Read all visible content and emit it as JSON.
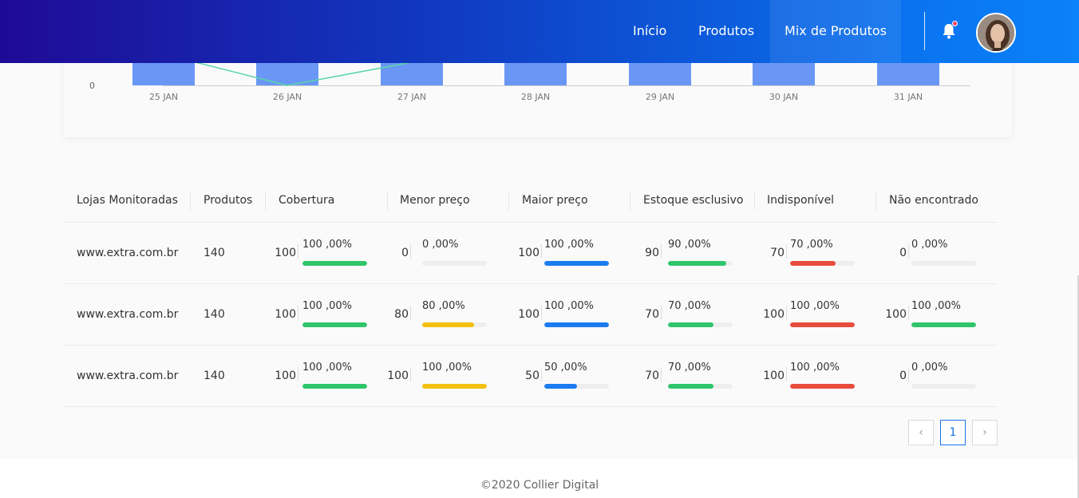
{
  "header": {
    "nav": [
      {
        "label": "Início"
      },
      {
        "label": "Produtos"
      },
      {
        "label": "Mix de Produtos"
      }
    ],
    "notification_badge": true,
    "icons": {
      "bell": "bell-icon",
      "avatar": "user-avatar"
    }
  },
  "chart_data": {
    "type": "bar",
    "categories": [
      "25 JAN",
      "26 JAN",
      "27 JAN",
      "28 JAN",
      "29 JAN",
      "30 JAN",
      "31 JAN"
    ],
    "y_visible_tick": "0",
    "bar_color": "#6a97f6",
    "line_color": "#5ad6a6",
    "line_points": [
      {
        "x": "25 JAN",
        "y": 0.6
      },
      {
        "x": "26 JAN",
        "y": 0
      },
      {
        "x": "27 JAN",
        "y": 0.6
      }
    ]
  },
  "table": {
    "headers": [
      "Lojas Monitoradas",
      "Produtos",
      "Cobertura",
      "Menor preço",
      "Maior preço",
      "Estoque esclusivo",
      "Indisponível",
      "Não encontrado"
    ],
    "rows": [
      {
        "store": "www.extra.com.br",
        "products": "140",
        "metrics": [
          {
            "num": "100",
            "pct": "100 ,00%",
            "value": 100
          },
          {
            "num": "0",
            "pct": "0 ,00%",
            "value": 0
          },
          {
            "num": "100",
            "pct": "100 ,00%",
            "value": 100
          },
          {
            "num": "90",
            "pct": "90 ,00%",
            "value": 90
          },
          {
            "num": "70",
            "pct": "70 ,00%",
            "value": 70
          },
          {
            "num": "0",
            "pct": "0 ,00%",
            "value": 0
          }
        ]
      },
      {
        "store": "www.extra.com.br",
        "products": "140",
        "metrics": [
          {
            "num": "100",
            "pct": "100 ,00%",
            "value": 100
          },
          {
            "num": "80",
            "pct": "80 ,00%",
            "value": 80
          },
          {
            "num": "100",
            "pct": "100 ,00%",
            "value": 100
          },
          {
            "num": "70",
            "pct": "70 ,00%",
            "value": 70
          },
          {
            "num": "100",
            "pct": "100 ,00%",
            "value": 100
          },
          {
            "num": "100",
            "pct": "100 ,00%",
            "value": 100
          }
        ]
      },
      {
        "store": "www.extra.com.br",
        "products": "140",
        "metrics": [
          {
            "num": "100",
            "pct": "100 ,00%",
            "value": 100
          },
          {
            "num": "100",
            "pct": "100 ,00%",
            "value": 100
          },
          {
            "num": "50",
            "pct": "50 ,00%",
            "value": 50
          },
          {
            "num": "70",
            "pct": "70 ,00%",
            "value": 70
          },
          {
            "num": "100",
            "pct": "100 ,00%",
            "value": 100
          },
          {
            "num": "0",
            "pct": "0 ,00%",
            "value": 0
          }
        ]
      }
    ],
    "metric_colors": [
      "#2fc56b",
      "#f2c00f",
      "#1a7cf0",
      "#2fc56b",
      "#e74c3c",
      "#2fc56b"
    ]
  },
  "pagination": {
    "prev": "‹",
    "current": "1",
    "next": "›"
  },
  "footer": {
    "text": "©2020 Collier Digital"
  }
}
